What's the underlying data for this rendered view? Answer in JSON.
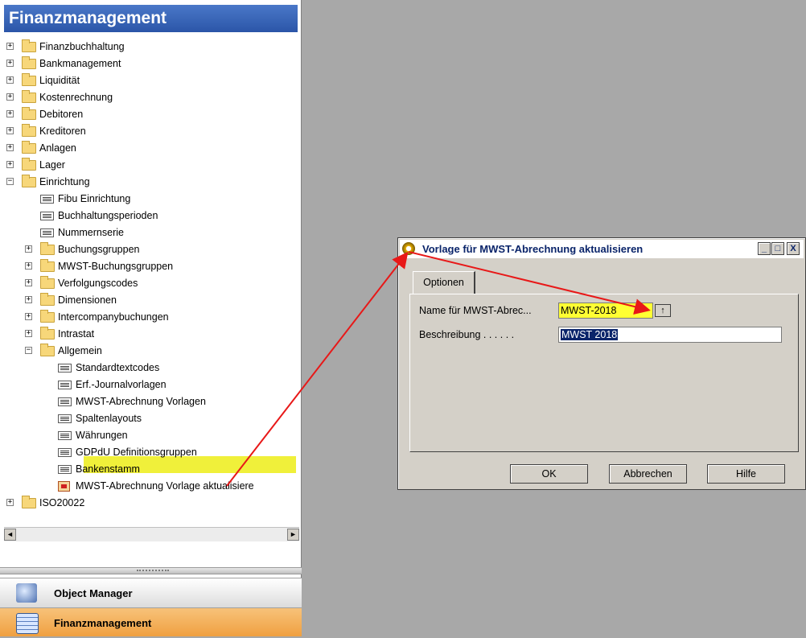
{
  "nav": {
    "title": "Finanzmanagement",
    "tree": [
      {
        "label": "Finanzbuchhaltung",
        "type": "folder",
        "level": 0,
        "expander": "+"
      },
      {
        "label": "Bankmanagement",
        "type": "folder",
        "level": 0,
        "expander": "+"
      },
      {
        "label": "Liquidität",
        "type": "folder",
        "level": 0,
        "expander": "+"
      },
      {
        "label": "Kostenrechnung",
        "type": "folder",
        "level": 0,
        "expander": "+"
      },
      {
        "label": "Debitoren",
        "type": "folder",
        "level": 0,
        "expander": "+"
      },
      {
        "label": "Kreditoren",
        "type": "folder",
        "level": 0,
        "expander": "+"
      },
      {
        "label": "Anlagen",
        "type": "folder",
        "level": 0,
        "expander": "+"
      },
      {
        "label": "Lager",
        "type": "folder",
        "level": 0,
        "expander": "+"
      },
      {
        "label": "Einrichtung",
        "type": "folder",
        "level": 0,
        "expander": "−"
      },
      {
        "label": "Fibu Einrichtung",
        "type": "form",
        "level": 1
      },
      {
        "label": "Buchhaltungsperioden",
        "type": "form",
        "level": 1
      },
      {
        "label": "Nummernserie",
        "type": "form",
        "level": 1
      },
      {
        "label": "Buchungsgruppen",
        "type": "folder",
        "level": 1,
        "expander": "+"
      },
      {
        "label": "MWST-Buchungsgruppen",
        "type": "folder",
        "level": 1,
        "expander": "+"
      },
      {
        "label": "Verfolgungscodes",
        "type": "folder",
        "level": 1,
        "expander": "+"
      },
      {
        "label": "Dimensionen",
        "type": "folder",
        "level": 1,
        "expander": "+"
      },
      {
        "label": "Intercompanybuchungen",
        "type": "folder",
        "level": 1,
        "expander": "+"
      },
      {
        "label": "Intrastat",
        "type": "folder",
        "level": 1,
        "expander": "+"
      },
      {
        "label": "Allgemein",
        "type": "folder",
        "level": 1,
        "expander": "−"
      },
      {
        "label": "Standardtextcodes",
        "type": "form",
        "level": 2
      },
      {
        "label": "Erf.-Journalvorlagen",
        "type": "form",
        "level": 2
      },
      {
        "label": "MWST-Abrechnung Vorlagen",
        "type": "form",
        "level": 2
      },
      {
        "label": "Spaltenlayouts",
        "type": "form",
        "level": 2
      },
      {
        "label": "Währungen",
        "type": "form",
        "level": 2
      },
      {
        "label": "GDPdU Definitionsgruppen",
        "type": "form",
        "level": 2
      },
      {
        "label": "Bankenstamm",
        "type": "form",
        "level": 2
      },
      {
        "label": "MWST-Abrechnung Vorlage aktualisiere",
        "type": "report",
        "level": 2
      },
      {
        "label": "ISO20022",
        "type": "folder",
        "level": 0,
        "expander": "+"
      }
    ],
    "buttons": [
      {
        "label": "Object Manager",
        "icon": "object-manager-icon"
      },
      {
        "label": "Finanzmanagement",
        "icon": "finanzmanagement-icon"
      }
    ],
    "scroll_left": "◄",
    "scroll_right": "►"
  },
  "dialog": {
    "title": "Vorlage für MWST-Abrechnung aktualisieren",
    "controls": {
      "minimize": "_",
      "maximize": "□",
      "close": "X"
    },
    "tab": "Optionen",
    "fields": [
      {
        "label": "Name für MWST-Abrec...",
        "value": "MWST-2018"
      },
      {
        "label": "Beschreibung . . . . . .",
        "value": "MWST 2018"
      }
    ],
    "lookup_glyph": "↑",
    "buttons": {
      "ok": "OK",
      "cancel": "Abbrechen",
      "help": "Hilfe"
    }
  },
  "colors": {
    "highlight": "#f0f03a",
    "annotation_arrow": "#e81818",
    "nav_header": "#2b55a8",
    "active_nav": "#f2a74a"
  }
}
